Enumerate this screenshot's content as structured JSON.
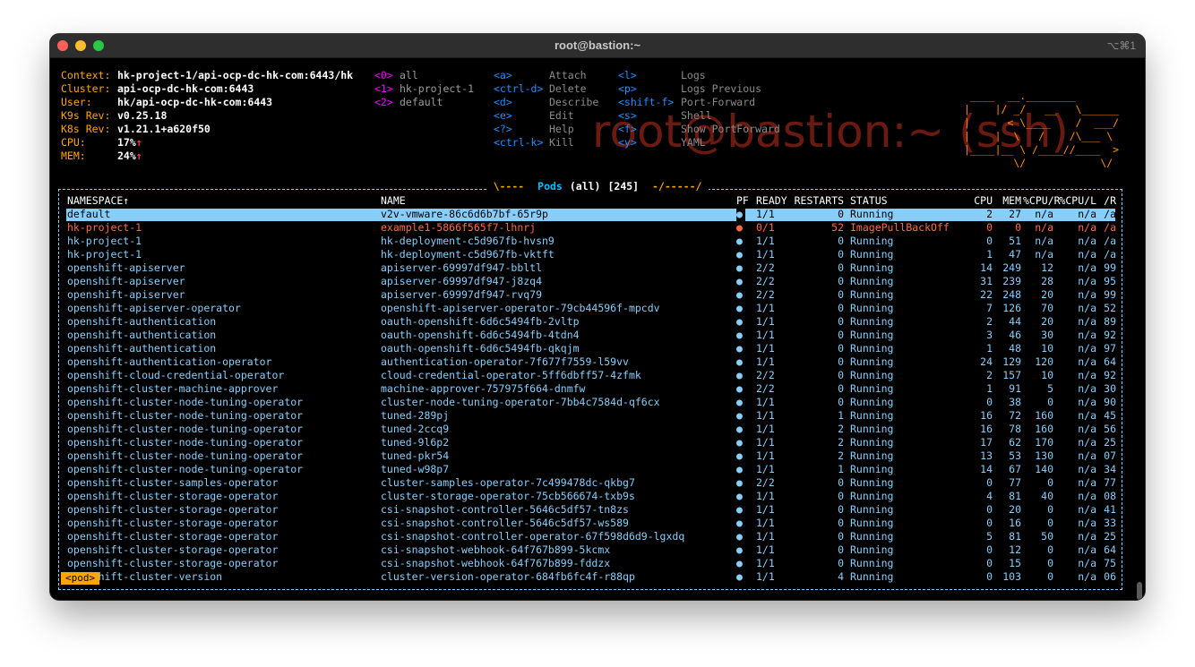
{
  "window": {
    "title": "root@bastion:~",
    "shortcut": "⌥⌘1"
  },
  "info": [
    {
      "label": "Context:",
      "value": "hk-project-1/api-ocp-dc-hk-com:6443/hk"
    },
    {
      "label": "Cluster:",
      "value": "api-ocp-dc-hk-com:6443"
    },
    {
      "label": "User:",
      "value": "hk/api-ocp-dc-hk-com:6443"
    },
    {
      "label": "K9s Rev:",
      "value": "v0.25.18"
    },
    {
      "label": "K8s Rev:",
      "value": "v1.21.1+a620f50"
    },
    {
      "label": "CPU:",
      "value": "17%",
      "arrow": "↑"
    },
    {
      "label": "MEM:",
      "value": "24%",
      "arrow": "↑"
    }
  ],
  "namespaces": [
    {
      "key": "<0>",
      "name": "all"
    },
    {
      "key": "<1>",
      "name": "hk-project-1"
    },
    {
      "key": "<2>",
      "name": "default"
    }
  ],
  "hotkeys_left": [
    {
      "key": "<a>",
      "desc": "Attach"
    },
    {
      "key": "<ctrl-d>",
      "desc": "Delete"
    },
    {
      "key": "<d>",
      "desc": "Describe"
    },
    {
      "key": "<e>",
      "desc": "Edit"
    },
    {
      "key": "<?>",
      "desc": "Help"
    },
    {
      "key": "<ctrl-k>",
      "desc": "Kill"
    }
  ],
  "hotkeys_right": [
    {
      "key": "<l>",
      "desc": "Logs"
    },
    {
      "key": "<p>",
      "desc": "Logs Previous"
    },
    {
      "key": "<shift-f>",
      "desc": "Port-Forward"
    },
    {
      "key": "<s>",
      "desc": "Shell"
    },
    {
      "key": "<f>",
      "desc": "Show PortForward"
    },
    {
      "key": "<y>",
      "desc": "YAML"
    }
  ],
  "watermark": "root@bastion:~ (ssh)",
  "logo": " ____  __.________\n|    |/ _/   __   \\______\n|      < \\____    /  ___/\n|    |  \\   /    /\\___ \\\n|____|__ \\ /____//____  >\n        \\/            \\/",
  "frame": {
    "prefix": "Pods",
    "scope": "(all)",
    "count": "[245]",
    "left_deco": "\\----",
    "right_deco": "-/-----/"
  },
  "colors": {
    "background": "#000000",
    "orange": "#ffa500",
    "row": "#87cefa",
    "error": "#ff6a3d",
    "selected_bg": "#87cefa"
  },
  "columns": [
    "NAMESPACE↑",
    "NAME",
    "PF",
    "READY",
    "RESTARTS",
    "STATUS",
    "CPU",
    "MEM",
    "%CPU/R",
    "%CPU/L",
    "/R"
  ],
  "rows": [
    [
      "default",
      "v2v-vmware-86c6d6b7bf-65r9p",
      "●",
      "1/1",
      "0",
      "Running",
      "2",
      "27",
      "n/a",
      "n/a",
      "/a"
    ],
    [
      "hk-project-1",
      "example1-5866f565f7-lhnrj",
      "●",
      "0/1",
      "52",
      "ImagePullBackOff",
      "0",
      "0",
      "n/a",
      "n/a",
      "/a"
    ],
    [
      "hk-project-1",
      "hk-deployment-c5d967fb-hvsn9",
      "●",
      "1/1",
      "0",
      "Running",
      "0",
      "51",
      "n/a",
      "n/a",
      "/a"
    ],
    [
      "hk-project-1",
      "hk-deployment-c5d967fb-vktft",
      "●",
      "1/1",
      "0",
      "Running",
      "1",
      "47",
      "n/a",
      "n/a",
      "/a"
    ],
    [
      "openshift-apiserver",
      "apiserver-69997df947-bbltl",
      "●",
      "2/2",
      "0",
      "Running",
      "14",
      "249",
      "12",
      "n/a",
      "99"
    ],
    [
      "openshift-apiserver",
      "apiserver-69997df947-j8zq4",
      "●",
      "2/2",
      "0",
      "Running",
      "31",
      "239",
      "28",
      "n/a",
      "95"
    ],
    [
      "openshift-apiserver",
      "apiserver-69997df947-rvq79",
      "●",
      "2/2",
      "0",
      "Running",
      "22",
      "248",
      "20",
      "n/a",
      "99"
    ],
    [
      "openshift-apiserver-operator",
      "openshift-apiserver-operator-79cb44596f-mpcdv",
      "●",
      "1/1",
      "0",
      "Running",
      "7",
      "126",
      "70",
      "n/a",
      "52"
    ],
    [
      "openshift-authentication",
      "oauth-openshift-6d6c5494fb-2vltp",
      "●",
      "1/1",
      "0",
      "Running",
      "2",
      "44",
      "20",
      "n/a",
      "89"
    ],
    [
      "openshift-authentication",
      "oauth-openshift-6d6c5494fb-4tdn4",
      "●",
      "1/1",
      "0",
      "Running",
      "3",
      "46",
      "30",
      "n/a",
      "92"
    ],
    [
      "openshift-authentication",
      "oauth-openshift-6d6c5494fb-qkqjm",
      "●",
      "1/1",
      "0",
      "Running",
      "1",
      "48",
      "10",
      "n/a",
      "97"
    ],
    [
      "openshift-authentication-operator",
      "authentication-operator-7f677f7559-l59vv",
      "●",
      "1/1",
      "0",
      "Running",
      "24",
      "129",
      "120",
      "n/a",
      "64"
    ],
    [
      "openshift-cloud-credential-operator",
      "cloud-credential-operator-5ff6dbff57-4zfmk",
      "●",
      "2/2",
      "0",
      "Running",
      "2",
      "157",
      "10",
      "n/a",
      "92"
    ],
    [
      "openshift-cluster-machine-approver",
      "machine-approver-757975f664-dnmfw",
      "●",
      "2/2",
      "0",
      "Running",
      "1",
      "91",
      "5",
      "n/a",
      "30"
    ],
    [
      "openshift-cluster-node-tuning-operator",
      "cluster-node-tuning-operator-7bb4c7584d-qf6cx",
      "●",
      "1/1",
      "0",
      "Running",
      "0",
      "38",
      "0",
      "n/a",
      "90"
    ],
    [
      "openshift-cluster-node-tuning-operator",
      "tuned-289pj",
      "●",
      "1/1",
      "1",
      "Running",
      "16",
      "72",
      "160",
      "n/a",
      "45"
    ],
    [
      "openshift-cluster-node-tuning-operator",
      "tuned-2ccq9",
      "●",
      "1/1",
      "2",
      "Running",
      "16",
      "78",
      "160",
      "n/a",
      "56"
    ],
    [
      "openshift-cluster-node-tuning-operator",
      "tuned-9l6p2",
      "●",
      "1/1",
      "2",
      "Running",
      "17",
      "62",
      "170",
      "n/a",
      "25"
    ],
    [
      "openshift-cluster-node-tuning-operator",
      "tuned-pkr54",
      "●",
      "1/1",
      "2",
      "Running",
      "13",
      "53",
      "130",
      "n/a",
      "07"
    ],
    [
      "openshift-cluster-node-tuning-operator",
      "tuned-w98p7",
      "●",
      "1/1",
      "1",
      "Running",
      "14",
      "67",
      "140",
      "n/a",
      "34"
    ],
    [
      "openshift-cluster-samples-operator",
      "cluster-samples-operator-7c499478dc-qkbg7",
      "●",
      "2/2",
      "0",
      "Running",
      "0",
      "77",
      "0",
      "n/a",
      "77"
    ],
    [
      "openshift-cluster-storage-operator",
      "cluster-storage-operator-75cb566674-txb9s",
      "●",
      "1/1",
      "0",
      "Running",
      "4",
      "81",
      "40",
      "n/a",
      "08"
    ],
    [
      "openshift-cluster-storage-operator",
      "csi-snapshot-controller-5646c5df57-tn8zs",
      "●",
      "1/1",
      "0",
      "Running",
      "0",
      "20",
      "0",
      "n/a",
      "41"
    ],
    [
      "openshift-cluster-storage-operator",
      "csi-snapshot-controller-5646c5df57-ws589",
      "●",
      "1/1",
      "0",
      "Running",
      "0",
      "16",
      "0",
      "n/a",
      "33"
    ],
    [
      "openshift-cluster-storage-operator",
      "csi-snapshot-controller-operator-67f598d6d9-lgxdq",
      "●",
      "1/1",
      "0",
      "Running",
      "5",
      "81",
      "50",
      "n/a",
      "25"
    ],
    [
      "openshift-cluster-storage-operator",
      "csi-snapshot-webhook-64f767b899-5kcmx",
      "●",
      "1/1",
      "0",
      "Running",
      "0",
      "12",
      "0",
      "n/a",
      "64"
    ],
    [
      "openshift-cluster-storage-operator",
      "csi-snapshot-webhook-64f767b899-fddzx",
      "●",
      "1/1",
      "0",
      "Running",
      "0",
      "15",
      "0",
      "n/a",
      "75"
    ],
    [
      "openshift-cluster-version",
      "cluster-version-operator-684fb6fc4f-r88qp",
      "●",
      "1/1",
      "4",
      "Running",
      "0",
      "103",
      "0",
      "n/a",
      "06"
    ]
  ],
  "selected_row": 0,
  "error_rows": [
    1
  ],
  "crumb": "<pod>"
}
